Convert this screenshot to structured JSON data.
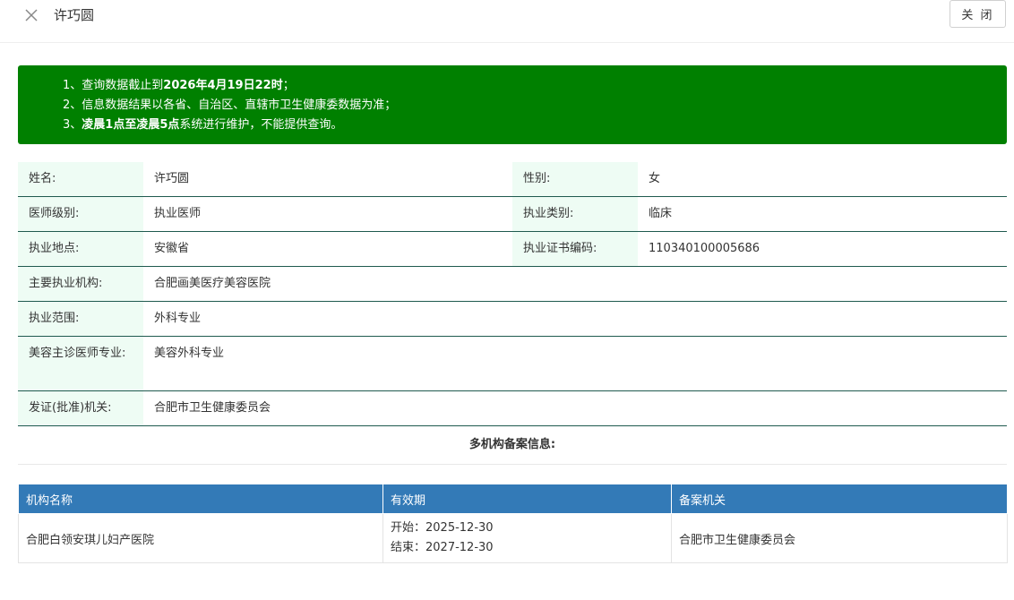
{
  "header": {
    "title": "许巧圆",
    "close_button_label": "关 闭"
  },
  "notice": {
    "bg_color": "#008000",
    "line1_prefix": "1、查询数据截止到",
    "line1_bold": "2026年4月19日22时",
    "line1_suffix": "；",
    "line2": "2、信息数据结果以各省、自治区、直辖市卫生健康委数据为准；",
    "line3_prefix": "3、",
    "line3_bold": "凌晨1点至凌晨5点",
    "line3_suffix": "系统进行维护，不能提供查询。"
  },
  "info": {
    "name_label": "姓名:",
    "name_value": "许巧圆",
    "gender_label": "性别:",
    "gender_value": "女",
    "level_label": "医师级别:",
    "level_value": "执业医师",
    "category_label": "执业类别:",
    "category_value": "临床",
    "location_label": "执业地点:",
    "location_value": "安徽省",
    "cert_label": "执业证书编码:",
    "cert_value": "110340100005686",
    "institution_label": "主要执业机构:",
    "institution_value": "合肥画美医疗美容医院",
    "scope_label": "执业范围:",
    "scope_value": "外科专业",
    "cosmetic_label": "美容主诊医师专业:",
    "cosmetic_value": "美容外科专业",
    "issuer_label": "发证(批准)机关:",
    "issuer_value": "合肥市卫生健康委员会"
  },
  "multi": {
    "title": "多机构备案信息:",
    "header_color": "#337ab7",
    "columns": [
      "机构名称",
      "有效期",
      "备案机关"
    ],
    "rows": [
      {
        "org": "合肥白领安琪儿妇产医院",
        "start": "开始：2025-12-30",
        "end": "结束：2027-12-30",
        "authority": "合肥市卫生健康委员会"
      }
    ]
  }
}
